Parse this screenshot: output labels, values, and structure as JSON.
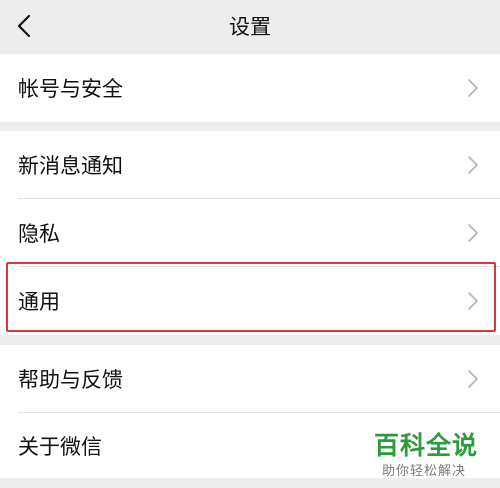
{
  "header": {
    "title": "设置",
    "back_icon": "chevron-left-icon"
  },
  "settings": {
    "account": "帐号与安全",
    "notifications": "新消息通知",
    "privacy": "隐私",
    "general": "通用",
    "help": "帮助与反馈",
    "about": "关于微信"
  },
  "row_chevron_icon": "chevron-right-icon",
  "highlight": {
    "target": "通用",
    "color": "#d9373b"
  },
  "watermark": {
    "main": "百科全说",
    "sub": "助你轻松解决",
    "color": "#2d9a3e"
  }
}
